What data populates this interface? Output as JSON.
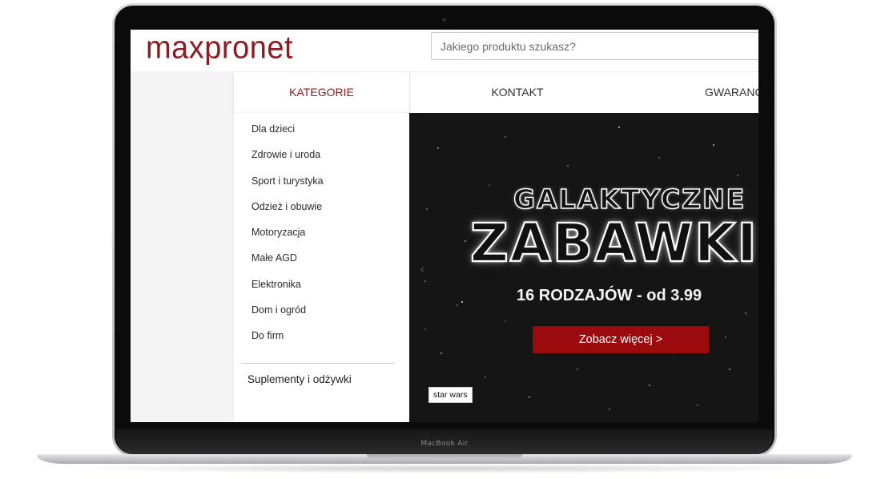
{
  "device": {
    "model_label": "MacBook Air"
  },
  "header": {
    "logo_text": "maxpronet",
    "brand_color": "#8b1c24",
    "search": {
      "placeholder": "Jakiego produktu szukasz?",
      "value": ""
    }
  },
  "nav": {
    "items": [
      {
        "label": "KATEGORIE",
        "active": true
      },
      {
        "label": "KONTAKT",
        "active": false
      },
      {
        "label": "GWARANCJ",
        "active": false
      }
    ]
  },
  "categories": {
    "items": [
      {
        "label": "Dla dzieci"
      },
      {
        "label": "Zdrowie i uroda"
      },
      {
        "label": "Sport i turystyka"
      },
      {
        "label": "Odzież i obuwie"
      },
      {
        "label": "Motoryzacja"
      },
      {
        "label": "Małe AGD"
      },
      {
        "label": "Elektronika"
      },
      {
        "label": "Dom i ogród"
      },
      {
        "label": "Do firm"
      }
    ],
    "special_label": "Suplementy i odżywki"
  },
  "banner": {
    "title_line1": "GALAKTYCZNE",
    "title_line2": "ZABAWKI",
    "subtitle": "16 RODZAJÓW - od 3.99",
    "cta_label": "Zobacz więcej  >",
    "cta_color": "#9b0b0e",
    "tag_label": "star wars",
    "prev_arrow": "‹"
  }
}
